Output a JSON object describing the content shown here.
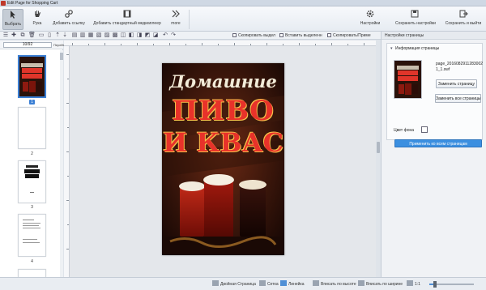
{
  "window": {
    "title": "Edit Page for Shopping Cart"
  },
  "ribbon": {
    "buttons": [
      {
        "id": "select",
        "label": "Выбрать",
        "icon": "cursor-icon",
        "active": true
      },
      {
        "id": "hand",
        "label": "Рука",
        "icon": "hand-icon",
        "active": false
      },
      {
        "id": "add_link",
        "label": "Добавить ссылку",
        "icon": "link-icon",
        "active": false
      },
      {
        "id": "add_media",
        "label": "Добавить стандартный медиаплеер",
        "icon": "media-player-icon",
        "active": false
      },
      {
        "id": "more",
        "label": "more",
        "icon": "more-icon",
        "active": false
      },
      {
        "id": "settings",
        "label": "Настройки",
        "icon": "gear-icon",
        "active": false
      },
      {
        "id": "save_settings",
        "label": "Сохранить настройки",
        "icon": "save-icon",
        "active": false
      },
      {
        "id": "save_exit",
        "label": "Сохранить и выйти",
        "icon": "exit-icon",
        "active": false
      }
    ]
  },
  "toolbar2": {
    "copy_selected": "Скопировать выдел",
    "paste_selected": "Вставить выделенн",
    "copy_apply": "Скопировать/Приме"
  },
  "page_nav": {
    "value": "10/92",
    "go_label": "Перейти"
  },
  "thumbnails": [
    {
      "number": "1",
      "selected": true
    },
    {
      "number": "2",
      "selected": false
    },
    {
      "number": "3",
      "selected": false
    },
    {
      "number": "4",
      "selected": false
    }
  ],
  "cover": {
    "line1": "Домашние",
    "line2": "ПИВО",
    "line3": "И КВАС"
  },
  "right_panel": {
    "header": "Настройки страницы",
    "section_title": "Информация страницы",
    "file_name": "page_20160829112830021_1.swf",
    "replace_page": "Заменить страницу",
    "replace_all_pages": "Заменить все страницы",
    "background_color_label": "Цвет фона",
    "apply_all": "Применить ко всем страницам"
  },
  "status": {
    "double_page": "Двойная Страница",
    "grid": "Сетка",
    "ruler": "Линейка",
    "fit_height": "Вписать по высоте",
    "fit_width": "Вписать по ширине",
    "ratio": "1:1",
    "zoom_level": 0.12,
    "colors": {
      "accent": "#3b8fe0",
      "selected": "#3b7fd4"
    }
  }
}
